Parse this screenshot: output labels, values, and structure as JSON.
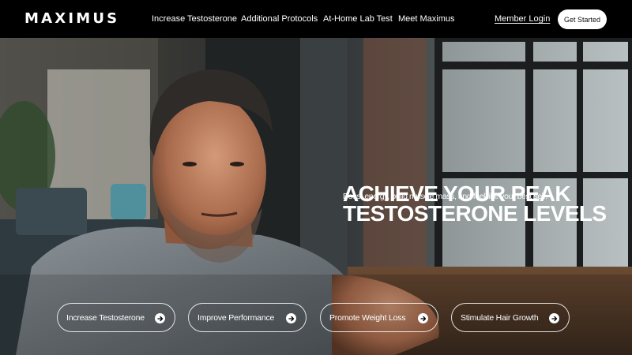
{
  "header": {
    "logo": "MAXIMUS",
    "nav": [
      {
        "label": "Increase Testosterone"
      },
      {
        "label": "Additional Protocols"
      },
      {
        "label": "At-Home Lab Test"
      },
      {
        "label": "Meet Maximus"
      }
    ],
    "member_login": "Member Login",
    "get_started": "Get Started"
  },
  "hero": {
    "headline_line1": "ACHIEVE YOUR PEAK",
    "headline_line2": "TESTOSTERONE LEVELS",
    "subhead": "Boost energy, build muscle mass, and feel like your best self.",
    "image_description_icon": "hero-photo"
  },
  "pills": [
    {
      "label": "Increase Testosterone",
      "icon": "arrow-right-icon"
    },
    {
      "label": "Improve Performance",
      "icon": "arrow-right-icon"
    },
    {
      "label": "Promote Weight Loss",
      "icon": "arrow-right-icon"
    },
    {
      "label": "Stimulate Hair Growth",
      "icon": "arrow-right-icon"
    }
  ],
  "colors": {
    "header_bg": "#000000",
    "button_bg": "#ffffff",
    "text": "#ffffff"
  }
}
